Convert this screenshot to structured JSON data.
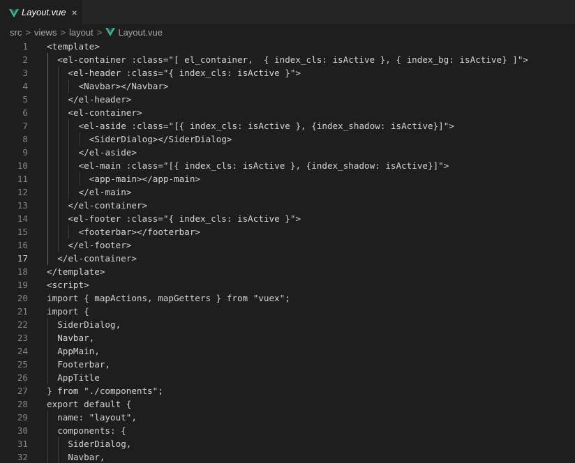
{
  "tab": {
    "label": "Layout.vue",
    "icon": "vue-icon",
    "close": "×"
  },
  "breadcrumb": {
    "items": [
      "src",
      "views",
      "layout",
      "Layout.vue"
    ],
    "separator": ">"
  },
  "editor": {
    "active_line": 17,
    "lines": [
      {
        "n": "1",
        "indent": 0,
        "text": "<template>"
      },
      {
        "n": "2",
        "indent": 1,
        "text": "<el-container :class=\"[ el_container,  { index_cls: isActive }, { index_bg: isActive} ]\">"
      },
      {
        "n": "3",
        "indent": 2,
        "text": "<el-header :class=\"{ index_cls: isActive }\">"
      },
      {
        "n": "4",
        "indent": 3,
        "text": "<Navbar></Navbar>"
      },
      {
        "n": "5",
        "indent": 2,
        "text": "</el-header>"
      },
      {
        "n": "6",
        "indent": 2,
        "text": "<el-container>"
      },
      {
        "n": "7",
        "indent": 3,
        "text": "<el-aside :class=\"[{ index_cls: isActive }, {index_shadow: isActive}]\">"
      },
      {
        "n": "8",
        "indent": 4,
        "text": "<SiderDialog></SiderDialog>"
      },
      {
        "n": "9",
        "indent": 3,
        "text": "</el-aside>"
      },
      {
        "n": "10",
        "indent": 3,
        "text": "<el-main :class=\"[{ index_cls: isActive }, {index_shadow: isActive}]\">"
      },
      {
        "n": "11",
        "indent": 4,
        "text": "<app-main></app-main>"
      },
      {
        "n": "12",
        "indent": 3,
        "text": "</el-main>"
      },
      {
        "n": "13",
        "indent": 2,
        "text": "</el-container>"
      },
      {
        "n": "14",
        "indent": 2,
        "text": "<el-footer :class=\"{ index_cls: isActive }\">"
      },
      {
        "n": "15",
        "indent": 3,
        "text": "<footerbar></footerbar>"
      },
      {
        "n": "16",
        "indent": 2,
        "text": "</el-footer>"
      },
      {
        "n": "17",
        "indent": 1,
        "text": "</el-container>"
      },
      {
        "n": "18",
        "indent": 0,
        "text": "</template>"
      },
      {
        "n": "19",
        "indent": 0,
        "text": "<script>"
      },
      {
        "n": "20",
        "indent": 0,
        "text": "import { mapActions, mapGetters } from \"vuex\";"
      },
      {
        "n": "21",
        "indent": 0,
        "text": "import {"
      },
      {
        "n": "22",
        "indent": 1,
        "text": "SiderDialog,"
      },
      {
        "n": "23",
        "indent": 1,
        "text": "Navbar,"
      },
      {
        "n": "24",
        "indent": 1,
        "text": "AppMain,"
      },
      {
        "n": "25",
        "indent": 1,
        "text": "Footerbar,"
      },
      {
        "n": "26",
        "indent": 1,
        "text": "AppTitle"
      },
      {
        "n": "27",
        "indent": 0,
        "text": "} from \"./components\";"
      },
      {
        "n": "28",
        "indent": 0,
        "text": "export default {"
      },
      {
        "n": "29",
        "indent": 1,
        "text": "name: \"layout\","
      },
      {
        "n": "30",
        "indent": 1,
        "text": "components: {"
      },
      {
        "n": "31",
        "indent": 2,
        "text": "SiderDialog,"
      },
      {
        "n": "32",
        "indent": 2,
        "text": "Navbar,"
      }
    ]
  },
  "colors": {
    "background": "#1e1e1e",
    "tabbar": "#252526",
    "text": "#d4d4d4",
    "line_number": "#858585",
    "active_line_number": "#c6c6c6",
    "vue_green": "#41b883",
    "vue_dark": "#35495e"
  }
}
